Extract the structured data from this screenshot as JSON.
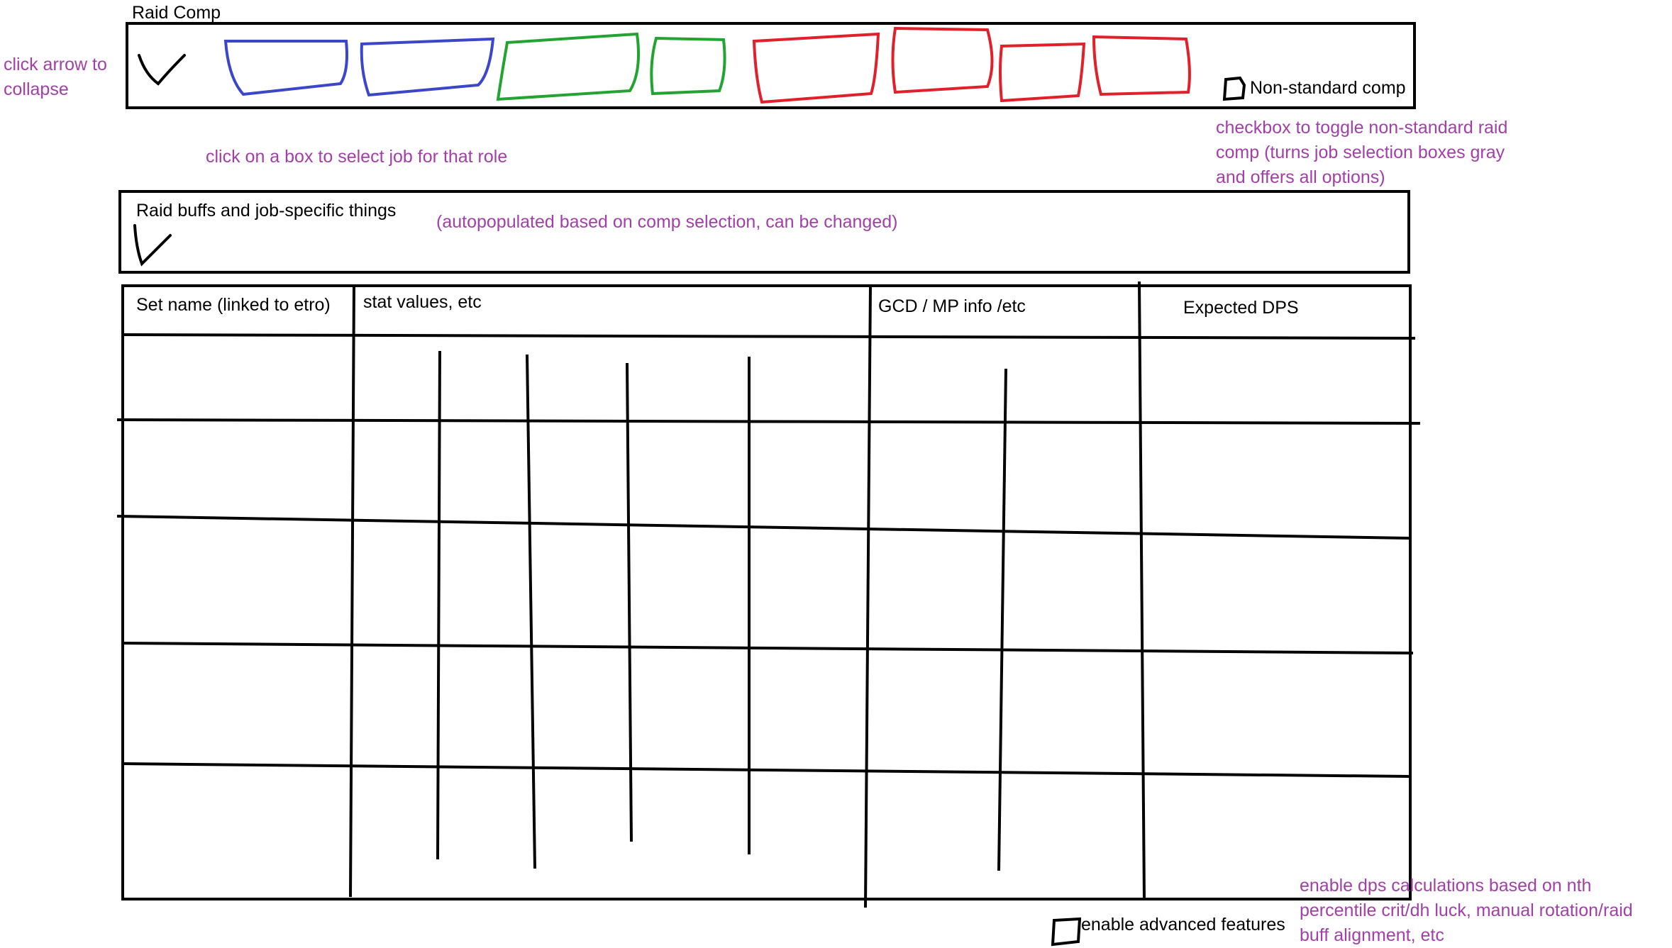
{
  "raid_comp": {
    "title": "Raid Comp",
    "collapse_hint": [
      "click arrow to",
      "collapse"
    ],
    "job_hint": "click on a box to select job for that role",
    "role_slots": [
      {
        "role": "tank",
        "color": "#3c46c8"
      },
      {
        "role": "tank",
        "color": "#3c46c8"
      },
      {
        "role": "healer",
        "color": "#22a332"
      },
      {
        "role": "healer",
        "color": "#22a332"
      },
      {
        "role": "dps",
        "color": "#e0202a"
      },
      {
        "role": "dps",
        "color": "#e0202a"
      },
      {
        "role": "dps",
        "color": "#e0202a"
      },
      {
        "role": "dps",
        "color": "#e0202a"
      }
    ],
    "nonstandard_label": "Non-standard comp",
    "nonstandard_hint": [
      "checkbox to toggle non-standard raid",
      "comp (turns job selection boxes gray",
      "and offers all options)"
    ]
  },
  "raid_buffs": {
    "title": "Raid buffs and job-specific things",
    "hint": "(autopopulated based on comp selection, can be changed)"
  },
  "table": {
    "headers": [
      "Set name (linked to etro)",
      "stat values, etc",
      "GCD / MP info /etc",
      "Expected DPS"
    ],
    "row_count": 5
  },
  "advanced": {
    "label": "enable advanced features",
    "hint": [
      "enable dps calculations based on nth",
      "percentile crit/dh luck, manual rotation/raid",
      "buff alignment, etc"
    ]
  },
  "colors": {
    "annotation": "#a23fa8",
    "tank": "#3c46c8",
    "healer": "#22a332",
    "dps": "#e0202a"
  },
  "icons": {
    "collapse": "chevron-down-icon",
    "checkbox": "checkbox-icon"
  }
}
